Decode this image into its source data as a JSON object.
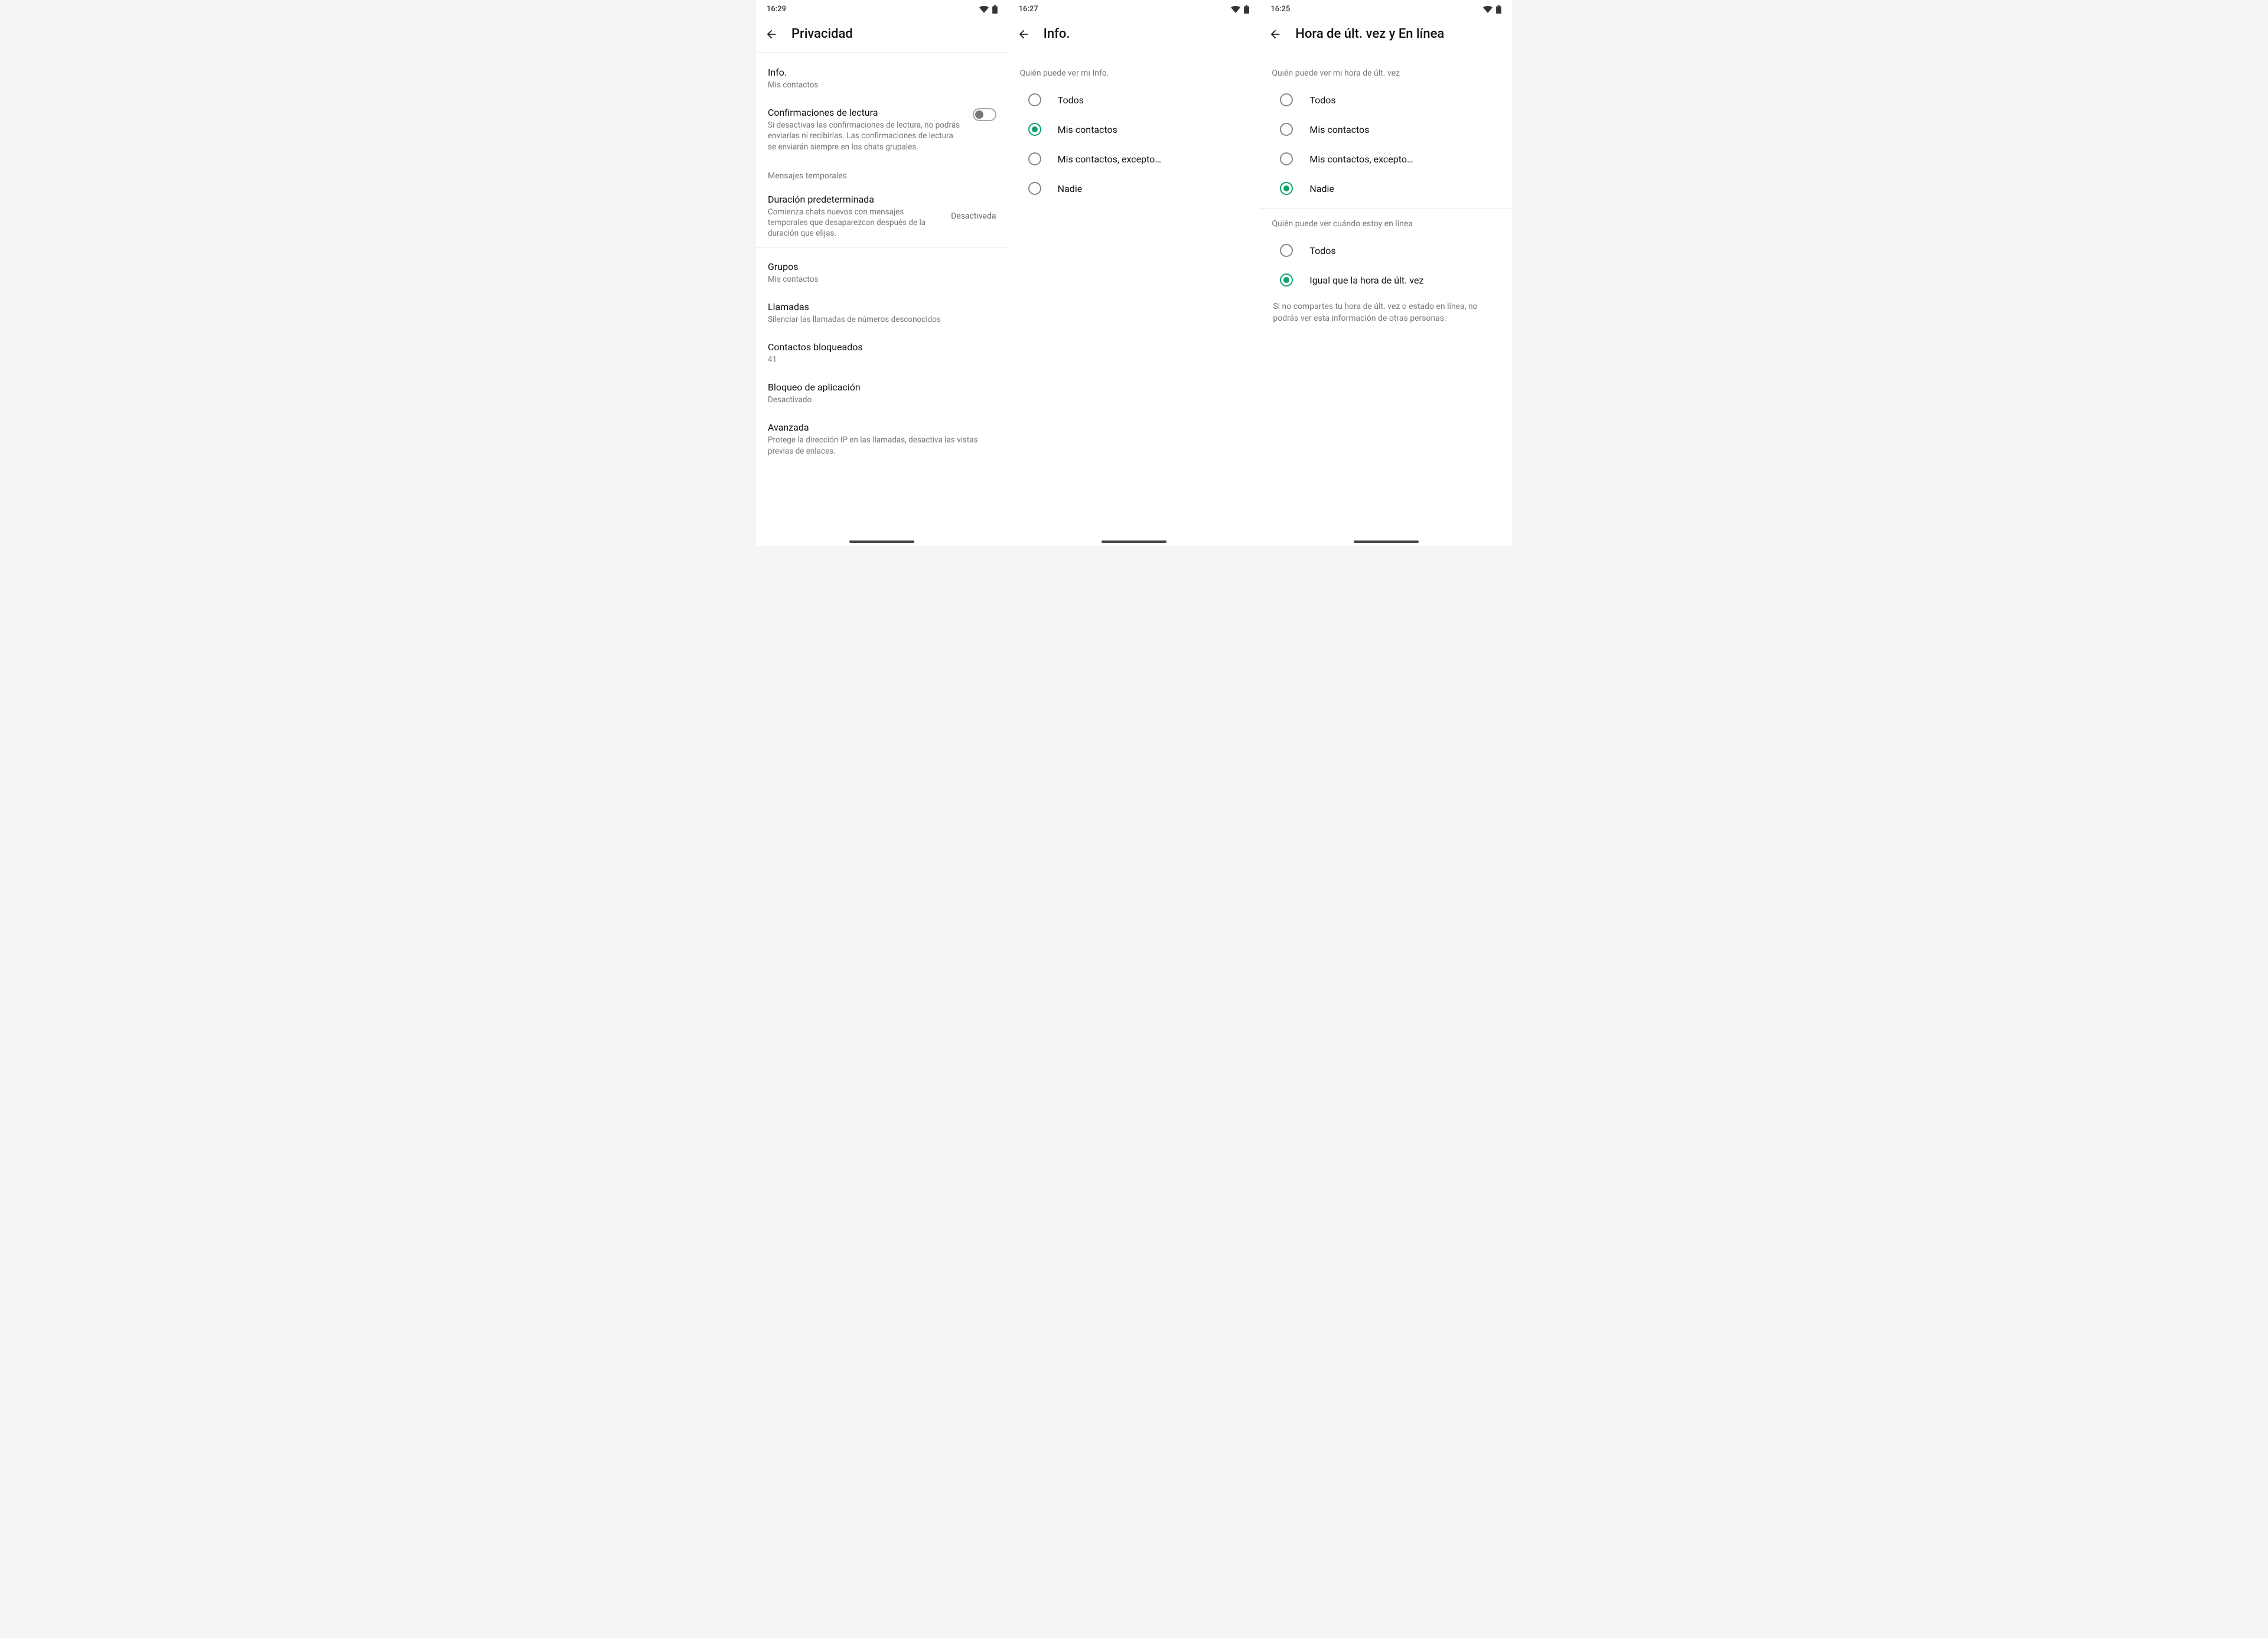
{
  "screen1": {
    "time": "16:29",
    "title": "Privacidad",
    "info": {
      "title": "Info.",
      "sub": "Mis contactos"
    },
    "readReceipts": {
      "title": "Confirmaciones de lectura",
      "sub": "Si desactivas las confirmaciones de lectura, no podrás enviarlas ni recibirlas. Las confirmaciones de lectura se enviarán siempre en los chats grupales."
    },
    "temporalHeader": "Mensajes temporales",
    "defaultDuration": {
      "title": "Duración predeterminada",
      "sub": "Comienza chats nuevos con mensajes temporales que desaparezcan después de la duración que elijas.",
      "value": "Desactivada"
    },
    "groups": {
      "title": "Grupos",
      "sub": "Mis contactos"
    },
    "calls": {
      "title": "Llamadas",
      "sub": "Silenciar las llamadas de números desconocidos"
    },
    "blocked": {
      "title": "Contactos bloqueados",
      "sub": "41"
    },
    "appLock": {
      "title": "Bloqueo de aplicación",
      "sub": "Desactivado"
    },
    "advanced": {
      "title": "Avanzada",
      "sub": "Protege la dirección IP en las llamadas, desactiva las vistas previas de enlaces."
    }
  },
  "screen2": {
    "time": "16:27",
    "title": "Info.",
    "header": "Quién puede ver mi Info.",
    "options": {
      "all": "Todos",
      "contacts": "Mis contactos",
      "except": "Mis contactos, excepto…",
      "nobody": "Nadie"
    }
  },
  "screen3": {
    "time": "16:25",
    "title": "Hora de últ. vez y En línea",
    "header1": "Quién puede ver mi hora de últ. vez",
    "options1": {
      "all": "Todos",
      "contacts": "Mis contactos",
      "except": "Mis contactos, excepto…",
      "nobody": "Nadie"
    },
    "header2": "Quién puede ver cuándo estoy en línea",
    "options2": {
      "all": "Todos",
      "same": "Igual que la hora de últ. vez"
    },
    "note": "Si no compartes tu hora de últ. vez o estado en línea, no podrás ver esta información de otras personas."
  }
}
